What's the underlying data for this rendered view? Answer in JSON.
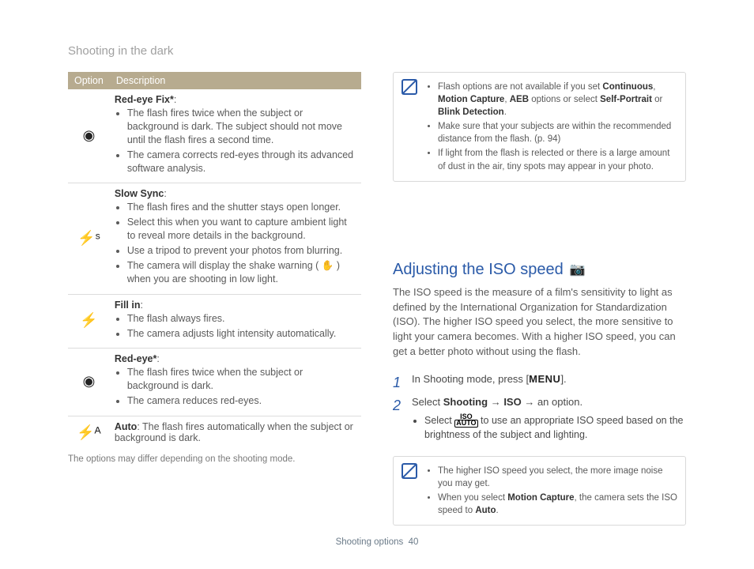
{
  "header": {
    "title": "Shooting in the dark"
  },
  "table": {
    "head_option": "Option",
    "head_desc": "Description",
    "rows": [
      {
        "icon": "◉",
        "title": "Red-eye Fix*",
        "colon": ":",
        "bullets": [
          "The flash fires twice when the subject or background is dark. The subject should not move until the flash fires a second time.",
          "The camera corrects red-eyes through its advanced software analysis."
        ]
      },
      {
        "icon": "⚡ˢ",
        "title": "Slow Sync",
        "colon": ":",
        "bullets": [
          "The flash fires and the shutter stays open longer.",
          "Select this when you want to capture ambient light to reveal more details in the background.",
          "Use a tripod to prevent your photos from blurring.",
          "The camera will display the shake warning ( ✋ ) when you are shooting in low light."
        ]
      },
      {
        "icon": "⚡",
        "title": "Fill in",
        "colon": ":",
        "bullets": [
          "The flash always fires.",
          "The camera adjusts light intensity automatically."
        ]
      },
      {
        "icon": "◉",
        "title": "Red-eye*",
        "colon": ":",
        "bullets": [
          "The flash fires twice when the subject or background is dark.",
          "The camera reduces red-eyes."
        ]
      },
      {
        "icon": "⚡ᴬ",
        "title": "Auto",
        "inline_text": ": The flash fires automatically when the subject or background is dark."
      }
    ],
    "footnote": "The options may differ depending on the shooting mode."
  },
  "note1": {
    "items": [
      {
        "pre": "Flash options are not available if you set ",
        "b1": "Continuous",
        "mid1": ", ",
        "b2": "Motion Capture",
        "mid2": ", ",
        "b3": "AEB",
        "mid3": " options or select ",
        "b4": "Self-Portrait",
        "mid4": " or ",
        "b5": "Blink Detection",
        "post": "."
      },
      {
        "text": "Make sure that your subjects are within the recommended distance from the flash. (p. 94)"
      },
      {
        "text": "If light from the flash is relected or there is a large amount of dust in the air, tiny spots may appear in your photo."
      }
    ]
  },
  "section": {
    "heading": "Adjusting the ISO speed",
    "intro": "The ISO speed is the measure of a film's sensitivity to light as defined by the International Organization for Standardization (ISO). The higher ISO speed you select, the more sensitive to light your camera becomes. With a higher ISO speed, you can get a better photo without using the flash.",
    "steps": [
      {
        "pre": "In Shooting mode, press [",
        "menu": "MENU",
        "post": "]."
      },
      {
        "pre": "Select ",
        "b1": "Shooting",
        "arrow1": " → ",
        "b2": "ISO",
        "arrow2": " → ",
        "tail": "an option.",
        "sub": [
          {
            "pre": "Select ",
            "iso_icon": true,
            "post": " to use an appropriate ISO speed based on the brightness of the subject and lighting."
          }
        ]
      }
    ]
  },
  "note2": {
    "items": [
      {
        "text": "The higher ISO speed you select, the more image noise you may get."
      },
      {
        "pre": "When you select ",
        "b1": "Motion Capture",
        "post": ", the camera sets the ISO speed to ",
        "b2": "Auto",
        "end": "."
      }
    ]
  },
  "footer": {
    "section": "Shooting options",
    "page": "40"
  }
}
